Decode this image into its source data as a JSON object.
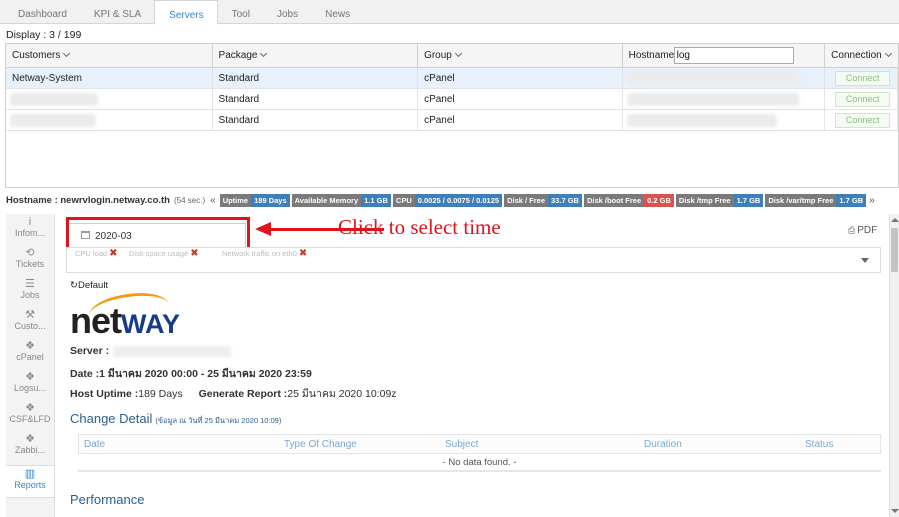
{
  "tabs": [
    "Dashboard",
    "KPI & SLA",
    "Servers",
    "Tool",
    "Jobs",
    "News"
  ],
  "active_tab": "Servers",
  "display": "Display : 3 / 199",
  "grid": {
    "headers": {
      "customers": "Customers",
      "package": "Package",
      "group": "Group",
      "hostname": "Hostname",
      "connection": "Connection"
    },
    "hostname_filter": "log",
    "rows": [
      {
        "customer": "Netway-System",
        "package": "Standard",
        "group": "cPanel",
        "action": "Connect"
      },
      {
        "customer": "",
        "package": "Standard",
        "group": "cPanel",
        "action": "Connect"
      },
      {
        "customer": "",
        "package": "Standard",
        "group": "cPanel",
        "action": "Connect"
      }
    ]
  },
  "hostbar": {
    "label": "Hostname : newrvlogin.netway.co.th",
    "refresh": "(54 sec.)",
    "prev": "«",
    "next": "»",
    "badges": [
      {
        "key": "Uptime",
        "value": "189 Days",
        "status": "ok"
      },
      {
        "key": "Available Memory",
        "value": "1.1 GB",
        "status": "ok"
      },
      {
        "key": "CPU",
        "value": "0.0025 / 0.0075 / 0.0125",
        "status": "ok"
      },
      {
        "key": "Disk / Free",
        "value": "33.7 GB",
        "status": "ok"
      },
      {
        "key": "Disk /boot Free",
        "value": "0.2 GB",
        "status": "warn"
      },
      {
        "key": "Disk /tmp Free",
        "value": "1.7 GB",
        "status": "ok"
      },
      {
        "key": "Disk /var/tmp Free",
        "value": "1.7 GB",
        "status": "ok"
      }
    ]
  },
  "sidebar": [
    {
      "label": "Infom...",
      "icon": "info-icon",
      "glyph": "i"
    },
    {
      "label": "Tickets",
      "icon": "tickets-icon",
      "glyph": "⟲"
    },
    {
      "label": "Jobs",
      "icon": "jobs-icon",
      "glyph": "☰"
    },
    {
      "label": "Custo...",
      "icon": "wrench-icon",
      "glyph": "⚒"
    },
    {
      "label": "cPanel",
      "icon": "cpanel-icon",
      "glyph": "❖"
    },
    {
      "label": "Logsu...",
      "icon": "logsu-icon",
      "glyph": "❖"
    },
    {
      "label": "CSF&LFD",
      "icon": "csf-icon",
      "glyph": "❖"
    },
    {
      "label": "Zabbi...",
      "icon": "zabbix-icon",
      "glyph": "❖"
    },
    {
      "label": "Reports",
      "icon": "reports-icon",
      "glyph": "▥"
    }
  ],
  "active_side": "Reports",
  "report": {
    "date": "2020-03",
    "annotation": "Click to select time",
    "pdf": "PDF",
    "chips": [
      "CPU load",
      "Disk space usage",
      "Network traffic on eth0"
    ],
    "default_link": "Default",
    "logo_net": "net",
    "logo_way": "WAY",
    "server_label": "Server :",
    "date_line": "Date :1 มีนาคม 2020 00:00 - 25 มีนาคม 2020 23:59",
    "uptime_label": "Host Uptime :",
    "uptime_value": "189 Days",
    "generate_label": "Generate Report :",
    "generate_value": "25 มีนาคม 2020 10:09z",
    "change_title": "Change Detail",
    "change_note": "(ข้อมูล ณ วันที่ 25 มีนาคม 2020 10:09)",
    "columns": [
      "Date",
      "Type Of Change",
      "Subject",
      "Duration",
      "Status"
    ],
    "no_data": "- No data found. -",
    "performance_title": "Performance"
  },
  "colors": {
    "accent": "#3a86c8",
    "annotation_red": "#e0121b",
    "badge_ok": "#3e7fb9",
    "badge_warn": "#d9534f",
    "connect_text": "#8cbf80"
  }
}
